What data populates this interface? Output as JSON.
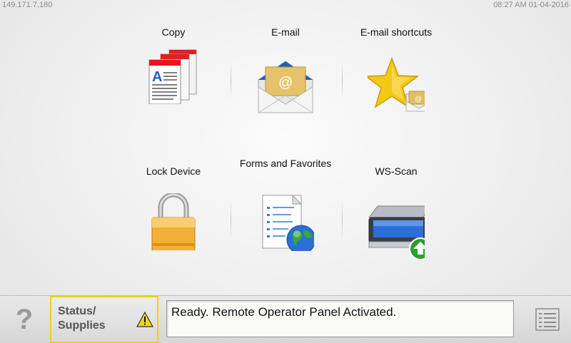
{
  "header": {
    "ip_address": "149.171.7.180",
    "datetime": "08:27 AM 01-04-2016"
  },
  "tiles": [
    {
      "label": "Copy",
      "icon": "copy-documents-icon"
    },
    {
      "label": "E-mail",
      "icon": "envelope-icon"
    },
    {
      "label": "E-mail shortcuts",
      "icon": "star-envelope-icon"
    },
    {
      "label": "Lock Device",
      "icon": "padlock-icon"
    },
    {
      "label": "Forms and Favorites",
      "icon": "form-globe-icon"
    },
    {
      "label": "WS-Scan",
      "icon": "scanner-upload-icon"
    }
  ],
  "bottom_bar": {
    "help_label": "?",
    "status_supplies_label": "Status/ Supplies",
    "status_message": "Ready. Remote Operator Panel Activated."
  },
  "colors": {
    "status_border": "#e8d21a",
    "warning": "#f2d21f"
  }
}
